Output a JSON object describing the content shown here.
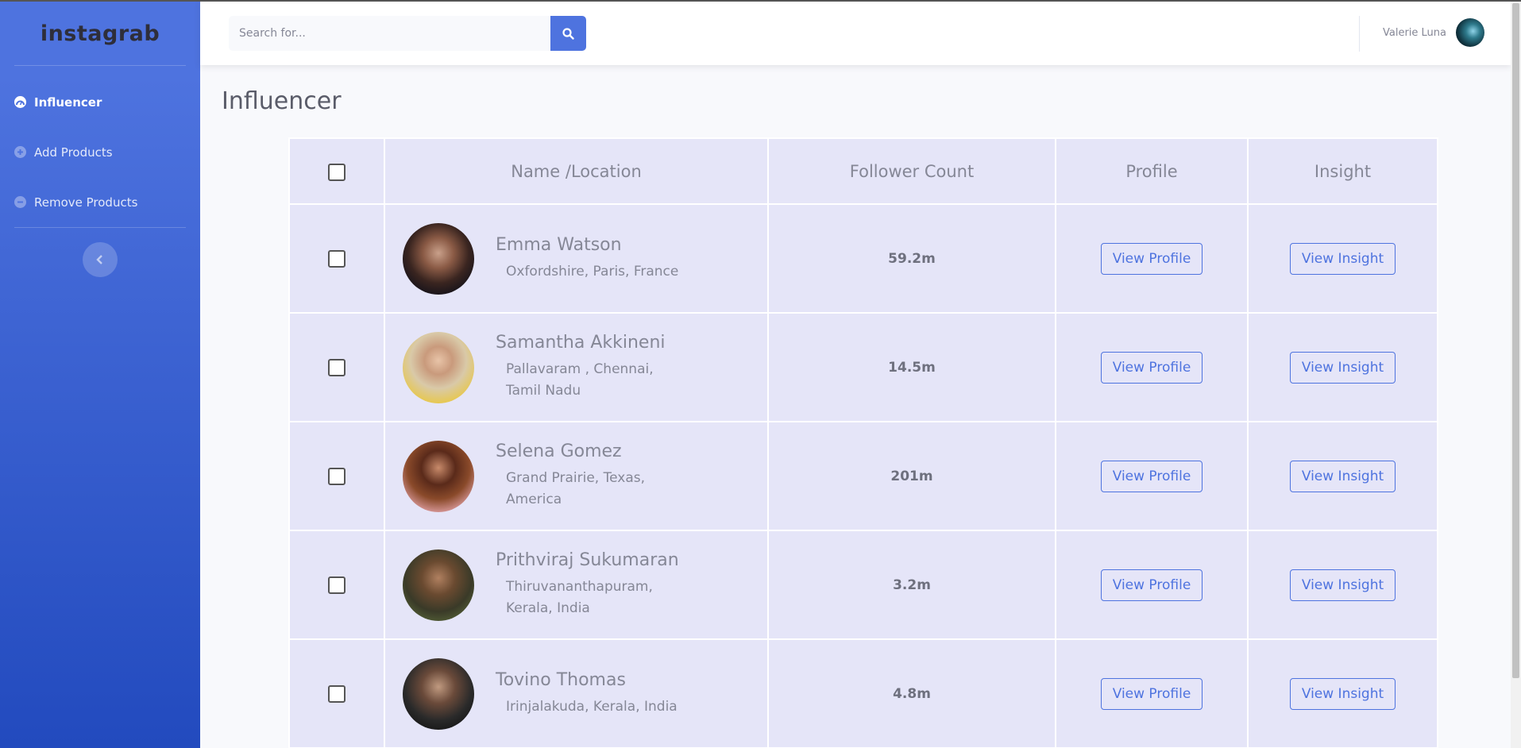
{
  "sidebar": {
    "brand": "instagrab",
    "items": [
      {
        "label": "Influencer",
        "icon": "tachometer-icon",
        "active": true
      },
      {
        "label": "Add Products",
        "icon": "plus-circle-icon",
        "active": false
      },
      {
        "label": "Remove Products",
        "icon": "minus-circle-icon",
        "active": false
      }
    ]
  },
  "topbar": {
    "search_placeholder": "Search for...",
    "user_name": "Valerie Luna"
  },
  "main": {
    "title": "Influencer",
    "table": {
      "headers": [
        "Name /Location",
        "Follower Count",
        "Profile",
        "Insight"
      ],
      "rows": [
        {
          "name": "Emma Watson",
          "location": "Oxfordshire, Paris, France",
          "followers": "59.2m",
          "profile_label": "View Profile",
          "insight_label": "View Insight"
        },
        {
          "name": "Samantha Akkineni",
          "location": "Pallavaram , Chennai, Tamil Nadu",
          "followers": "14.5m",
          "profile_label": "View Profile",
          "insight_label": "View Insight"
        },
        {
          "name": "Selena Gomez",
          "location": "Grand Prairie, Texas, America",
          "followers": "201m",
          "profile_label": "View Profile",
          "insight_label": "View Insight"
        },
        {
          "name": "Prithviraj Sukumaran",
          "location": "Thiruvananthapuram, Kerala, India",
          "followers": "3.2m",
          "profile_label": "View Profile",
          "insight_label": "View Insight"
        },
        {
          "name": "Tovino Thomas",
          "location": "Irinjalakuda, Kerala, India",
          "followers": "4.8m",
          "profile_label": "View Profile",
          "insight_label": "View Insight"
        }
      ]
    }
  },
  "colors": {
    "primary": "#4e73df",
    "table_bg": "#e5e5f8",
    "text_muted": "#858796"
  }
}
